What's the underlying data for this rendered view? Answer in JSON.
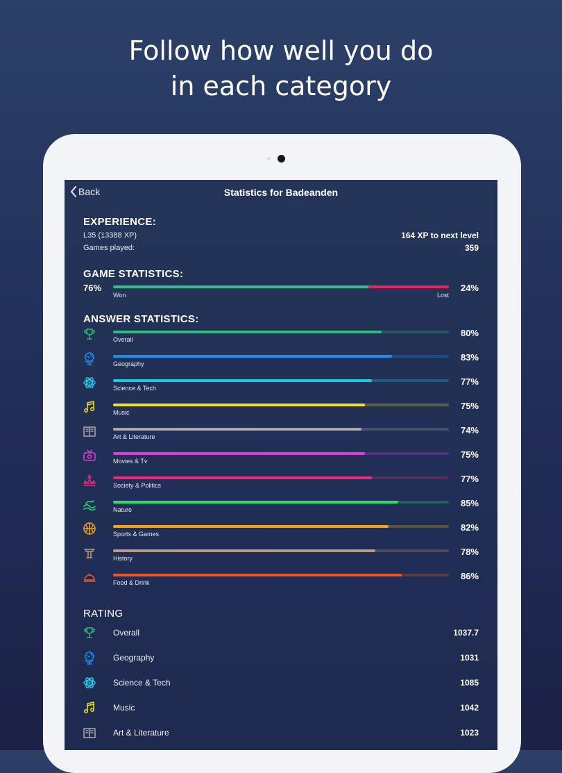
{
  "headline": {
    "line1": "Follow how well you do",
    "line2": "in each category"
  },
  "nav": {
    "back_label": "Back",
    "title": "Statistics for Badeanden"
  },
  "experience": {
    "heading": "EXPERIENCE:",
    "level": "L35 (13388 XP)",
    "next_level": "164 XP to next level",
    "games_played_label": "Games played:",
    "games_played": "359"
  },
  "game_stats": {
    "heading": "GAME STATISTICS:",
    "won_pct": "76%",
    "lost_pct": "24%",
    "won_label": "Won",
    "lost_label": "Lost",
    "won_fraction": 0.76,
    "won_color": "#2fbf8a",
    "lost_color": "#e8245a"
  },
  "answer_stats": {
    "heading": "ANSWER STATISTICS:",
    "items": [
      {
        "name": "Overall",
        "pct": "80%",
        "value": 0.8,
        "color": "#2dbf7c",
        "icon": "trophy-icon"
      },
      {
        "name": "Geography",
        "pct": "83%",
        "value": 0.83,
        "color": "#1c8ef0",
        "icon": "globe-icon"
      },
      {
        "name": "Science & Tech",
        "pct": "77%",
        "value": 0.77,
        "color": "#19c9e8",
        "icon": "atom-icon"
      },
      {
        "name": "Music",
        "pct": "75%",
        "value": 0.75,
        "color": "#f2e318",
        "icon": "music-note-icon"
      },
      {
        "name": "Art & Literature",
        "pct": "74%",
        "value": 0.74,
        "color": "#a9a9a9",
        "icon": "book-icon"
      },
      {
        "name": "Movies & Tv",
        "pct": "75%",
        "value": 0.75,
        "color": "#d93ed9",
        "icon": "tv-icon"
      },
      {
        "name": "Society & Politics",
        "pct": "77%",
        "value": 0.77,
        "color": "#ea2a7d",
        "icon": "society-icon"
      },
      {
        "name": "Nature",
        "pct": "85%",
        "value": 0.85,
        "color": "#27e06b",
        "icon": "nature-icon"
      },
      {
        "name": "Sports & Games",
        "pct": "82%",
        "value": 0.82,
        "color": "#f3a21c",
        "icon": "basketball-icon"
      },
      {
        "name": "History",
        "pct": "78%",
        "value": 0.78,
        "color": "#b89a86",
        "icon": "history-icon"
      },
      {
        "name": "Food & Drink",
        "pct": "86%",
        "value": 0.86,
        "color": "#f0572a",
        "icon": "cloche-icon"
      }
    ]
  },
  "rating": {
    "heading": "RATING",
    "items": [
      {
        "name": "Overall",
        "value": "1037.7",
        "color": "#2dbf7c",
        "icon": "trophy-icon"
      },
      {
        "name": "Geography",
        "value": "1031",
        "color": "#1c8ef0",
        "icon": "globe-icon"
      },
      {
        "name": "Science & Tech",
        "value": "1085",
        "color": "#19c9e8",
        "icon": "atom-icon"
      },
      {
        "name": "Music",
        "value": "1042",
        "color": "#f2e318",
        "icon": "music-note-icon"
      },
      {
        "name": "Art & Literature",
        "value": "1023",
        "color": "#a9a9a9",
        "icon": "book-icon"
      }
    ]
  }
}
